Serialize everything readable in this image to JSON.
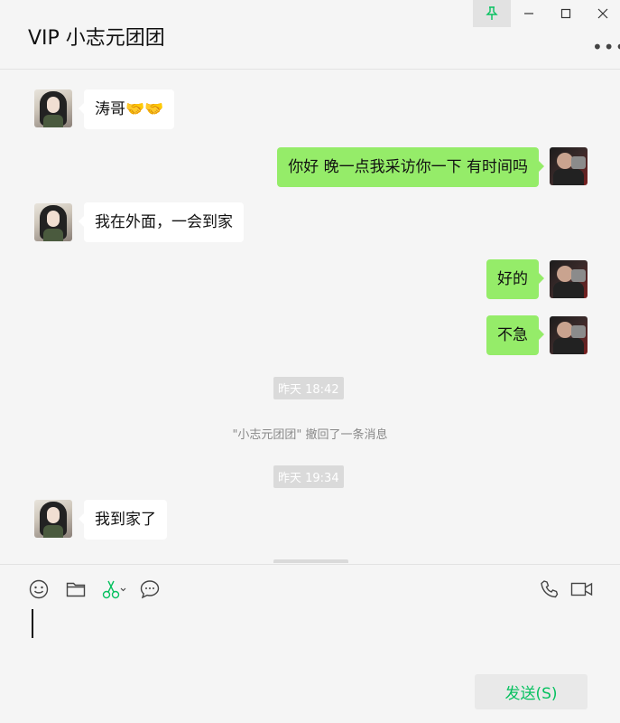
{
  "window": {
    "title": "VIP 小志元团团",
    "colors": {
      "bubble_sent": "#95ec69",
      "bubble_received": "#ffffff",
      "accent": "#07c160",
      "background": "#f5f5f5"
    }
  },
  "messages": [
    {
      "side": "left",
      "text": "涛哥🤝🤝"
    },
    {
      "side": "right",
      "text": "你好 晚一点我采访你一下 有时间吗"
    },
    {
      "side": "left",
      "text": "我在外面，一会到家"
    },
    {
      "side": "right",
      "text": "好的"
    },
    {
      "side": "right",
      "text": "不急"
    }
  ],
  "system": {
    "time1": "昨天 18:42",
    "recall_notice": "\"小志元团团\" 撤回了一条消息",
    "time2": "昨天 19:34"
  },
  "messages_after": [
    {
      "side": "left",
      "text": "我到家了"
    }
  ],
  "toolbar": {
    "icons": [
      "emoji-icon",
      "folder-icon",
      "scissors-icon",
      "chat-bubble-icon",
      "phone-icon",
      "video-icon"
    ]
  },
  "input": {
    "value": ""
  },
  "send_button": {
    "label": "发送(S)"
  }
}
